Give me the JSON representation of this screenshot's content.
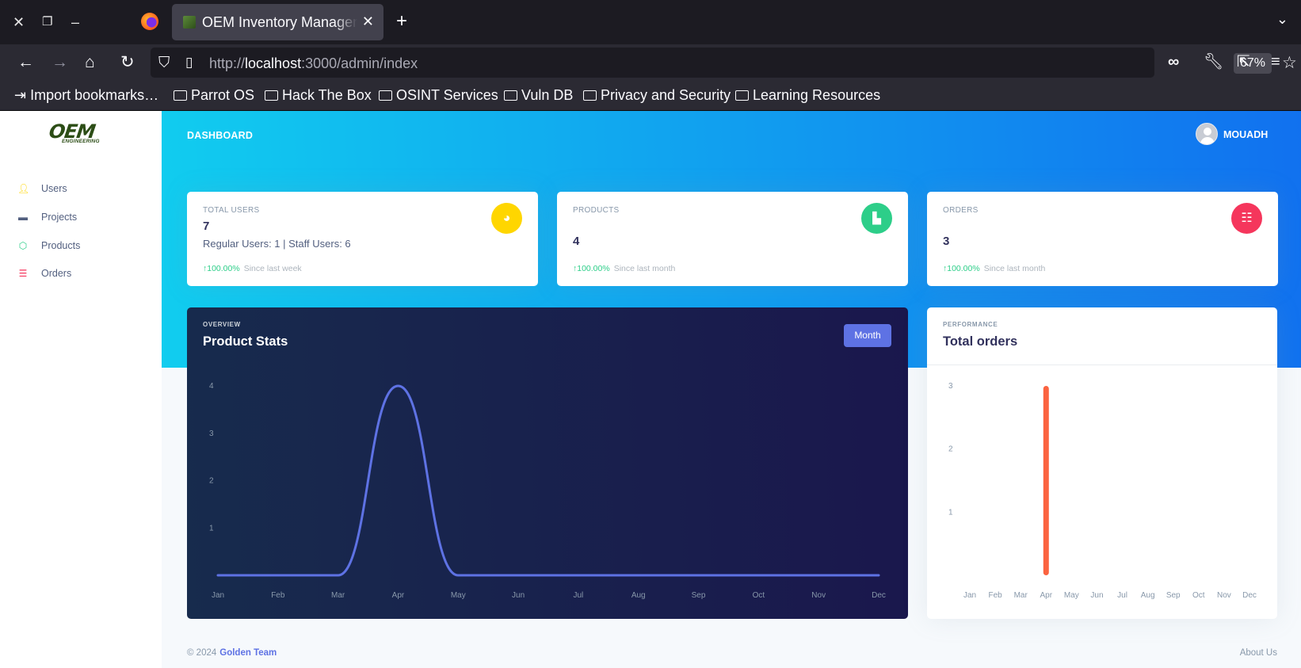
{
  "browser": {
    "tab_title": "OEM Inventory Management",
    "url_prefix": "http://",
    "url_host": "localhost",
    "url_rest": ":3000/admin/index",
    "zoom": "67%",
    "bookmarks": [
      "Import bookmarks…",
      "Parrot OS",
      "Hack The Box",
      "OSINT Services",
      "Vuln DB",
      "Privacy and Security",
      "Learning Resources"
    ]
  },
  "brand": {
    "name": "OEM",
    "tagline": "ENGINEERING"
  },
  "sidebar": {
    "items": [
      {
        "label": "Users",
        "icon": "user-icon",
        "color": "#ffd600"
      },
      {
        "label": "Projects",
        "icon": "briefcase-icon",
        "color": "#525f7f"
      },
      {
        "label": "Products",
        "icon": "cube-icon",
        "color": "#2dce89"
      },
      {
        "label": "Orders",
        "icon": "list-icon",
        "color": "#f5365c"
      }
    ]
  },
  "header": {
    "title": "DASHBOARD",
    "user": "MOUADH"
  },
  "stats": [
    {
      "title": "TOTAL USERS",
      "value": "7",
      "sub": "Regular Users: 1 | Staff Users: 6",
      "change": "100.00%",
      "since": "Since last week",
      "icon": "pie-chart-icon",
      "color": "#ffd600"
    },
    {
      "title": "PRODUCTS",
      "value": "4",
      "change": "100.00%",
      "since": "Since last month",
      "icon": "bar-chart-icon",
      "color": "#2dce89"
    },
    {
      "title": "ORDERS",
      "value": "3",
      "change": "100.00%",
      "since": "Since last month",
      "icon": "tasks-icon",
      "color": "#f5365c"
    }
  ],
  "overview": {
    "overline": "OVERVIEW",
    "title": "Product Stats",
    "button": "Month"
  },
  "performance": {
    "overline": "PERFORMANCE",
    "title": "Total orders"
  },
  "chart_data": [
    {
      "type": "line",
      "title": "Product Stats",
      "categories": [
        "Jan",
        "Feb",
        "Mar",
        "Apr",
        "May",
        "Jun",
        "Jul",
        "Aug",
        "Sep",
        "Oct",
        "Nov",
        "Dec"
      ],
      "values": [
        0,
        0,
        0,
        4,
        0,
        0,
        0,
        0,
        0,
        0,
        0,
        0
      ],
      "yticks": [
        1,
        2,
        3,
        4
      ],
      "ylim": [
        0,
        4
      ],
      "color": "#5e72e4"
    },
    {
      "type": "bar",
      "title": "Total orders",
      "categories": [
        "Jan",
        "Feb",
        "Mar",
        "Apr",
        "May",
        "Jun",
        "Jul",
        "Aug",
        "Sep",
        "Oct",
        "Nov",
        "Dec"
      ],
      "values": [
        0,
        0,
        0,
        3,
        0,
        0,
        0,
        0,
        0,
        0,
        0,
        0
      ],
      "yticks": [
        1,
        2,
        3
      ],
      "ylim": [
        0,
        3
      ],
      "color": "#fb6340"
    }
  ],
  "footer": {
    "copyright": "© 2024",
    "team": "Golden Team",
    "about": "About Us"
  }
}
